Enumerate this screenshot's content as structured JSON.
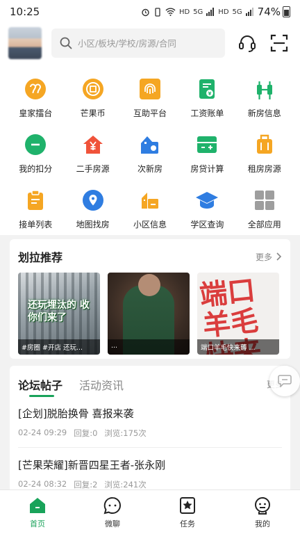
{
  "status_bar": {
    "time": "10:25",
    "network_1": "HD",
    "network_2": "5G",
    "network_3": "HD",
    "network_4": "5G",
    "battery": "74%"
  },
  "search": {
    "placeholder": "小区/板块/学校/房源/合同"
  },
  "grid": {
    "items": [
      {
        "label": "皇家擂台",
        "icon": "trophy-icon",
        "color": "#f5a623"
      },
      {
        "label": "芒果币",
        "icon": "coin-icon",
        "color": "#f5a623"
      },
      {
        "label": "互助平台",
        "icon": "fingerprint-icon",
        "color": "#f5a623"
      },
      {
        "label": "工资账单",
        "icon": "bill-icon",
        "color": "#1fb26b"
      },
      {
        "label": "新房信息",
        "icon": "building-icon",
        "color": "#1fb26b"
      },
      {
        "label": "我的扣分",
        "icon": "minus-circle-icon",
        "color": "#1fb26b"
      },
      {
        "label": "二手房源",
        "icon": "house-yen-icon",
        "color": "#f0533a"
      },
      {
        "label": "次新房",
        "icon": "new-house-icon",
        "color": "#2f7de1"
      },
      {
        "label": "房贷计算",
        "icon": "calculator-icon",
        "color": "#1fb26b"
      },
      {
        "label": "租房房源",
        "icon": "suitcase-icon",
        "color": "#f5a623"
      },
      {
        "label": "接单列表",
        "icon": "clipboard-icon",
        "color": "#f5a623"
      },
      {
        "label": "地图找房",
        "icon": "map-pin-icon",
        "color": "#2f7de1"
      },
      {
        "label": "小区信息",
        "icon": "community-icon",
        "color": "#f5a623"
      },
      {
        "label": "学区查询",
        "icon": "graduation-cap-icon",
        "color": "#2f7de1"
      },
      {
        "label": "全部应用",
        "icon": "apps-grid-icon",
        "color": "#9e9e9e"
      }
    ]
  },
  "recommend": {
    "title": "划拉推荐",
    "more": "更多",
    "items": [
      {
        "caption": "#房圈 #开店 还玩...",
        "overlay": "还玩埋汰的 收你们来了"
      },
      {
        "caption": "..."
      },
      {
        "caption": "端口羊毛快来薅 ...",
        "overlay": "端口 羊毛 快来"
      }
    ]
  },
  "forum": {
    "tab_active": "论坛帖子",
    "tab_other": "活动资讯",
    "more": "更多",
    "posts": [
      {
        "title": "[企划]脱胎换骨 喜报来袭",
        "date": "02-24 09:29",
        "replies": "回复:0",
        "views": "浏览:175次"
      },
      {
        "title": "[芒果荣耀]新晋四星王者-张永刚",
        "date": "02-24 08:32",
        "replies": "回复:2",
        "views": "浏览:241次"
      }
    ]
  },
  "tabbar": {
    "items": [
      {
        "label": "首页",
        "active": true
      },
      {
        "label": "微聊"
      },
      {
        "label": "任务"
      },
      {
        "label": "我的"
      }
    ]
  },
  "colors": {
    "brand": "#19a35a",
    "orange": "#f5a623"
  }
}
